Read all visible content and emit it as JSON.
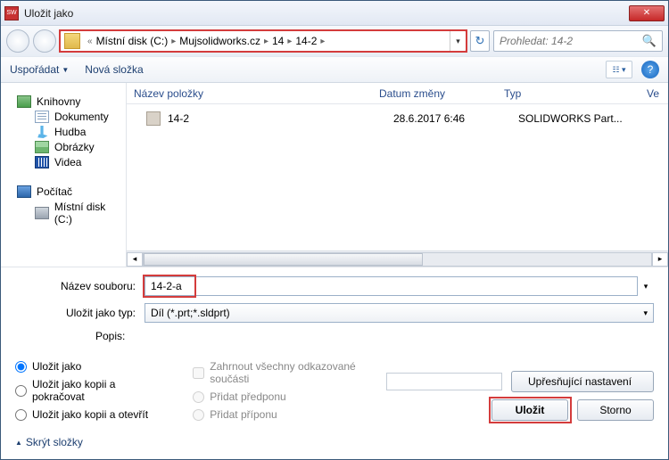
{
  "title": "Uložit jako",
  "path": {
    "prefix": "«",
    "crumbs": [
      "Místní disk (C:)",
      "Mujsolidworks.cz",
      "14",
      "14-2"
    ]
  },
  "search": {
    "placeholder": "Prohledat: 14-2"
  },
  "toolbar": {
    "organize": "Uspořádat",
    "newfolder": "Nová složka"
  },
  "sidebar": {
    "groups": [
      {
        "label": "Knihovny",
        "items": [
          "Dokumenty",
          "Hudba",
          "Obrázky",
          "Videa"
        ]
      },
      {
        "label": "Počítač",
        "items": [
          "Místní disk (C:)"
        ]
      }
    ]
  },
  "columns": {
    "name": "Název položky",
    "date": "Datum změny",
    "type": "Typ",
    "size": "Ve"
  },
  "files": [
    {
      "name": "14-2",
      "date": "28.6.2017 6:46",
      "type": "SOLIDWORKS Part..."
    }
  ],
  "form": {
    "name_label": "Název souboru:",
    "name_value": "14-2-a",
    "type_label": "Uložit jako typ:",
    "type_value": "Díl (*.prt;*.sldprt)",
    "desc_label": "Popis:"
  },
  "options": {
    "saveas": "Uložit jako",
    "copycont": "Uložit jako kopii a pokračovat",
    "copyopen": "Uložit jako kopii a otevřít",
    "includeref": "Zahrnout všechny odkazované součásti",
    "prefix": "Přidat předponu",
    "suffix": "Přidat příponu",
    "advanced": "Upřesňující nastavení"
  },
  "buttons": {
    "save": "Uložit",
    "cancel": "Storno"
  },
  "footer": "Skrýt složky"
}
